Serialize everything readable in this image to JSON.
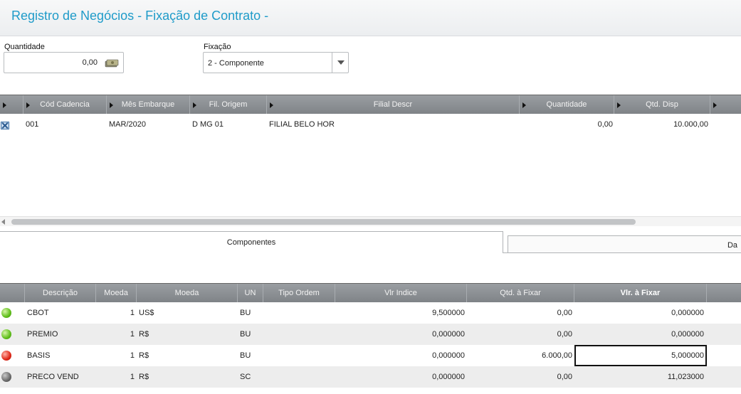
{
  "window": {
    "title": "Registro de Negócios - Fixação de Contrato -"
  },
  "form": {
    "quantidade_label": "Quantidade",
    "quantidade_value": "0,00",
    "fixacao_label": "Fixação",
    "fixacao_value": "2 - Componente"
  },
  "cadencia_grid": {
    "columns": [
      "Cód Cadencia",
      "Mês Embarque",
      "Fil. Origem",
      "Filial Descr",
      "Quantidade",
      "Qtd. Disp"
    ],
    "rows": [
      {
        "checked": true,
        "cod": "001",
        "mes": "MAR/2020",
        "fil_origem": "D MG 01",
        "filial_descr": "FILIAL BELO HOR",
        "quantidade": "0,00",
        "qtd_disp": "10.000,00"
      }
    ]
  },
  "tabs": {
    "componentes": "Componentes",
    "second": "Da"
  },
  "componentes_grid": {
    "columns": [
      "Descrição",
      "Moeda",
      "Moeda",
      "UN",
      "Tipo Ordem",
      "Vlr Indice",
      "Qtd. à Fixar",
      "Vlr. à Fixar"
    ],
    "rows": [
      {
        "status": "green",
        "descricao": "CBOT",
        "moeda_num": "1",
        "moeda": "US$",
        "un": "BU",
        "tipo_ordem": "",
        "vlr_indice": "9,500000",
        "qtd_fixar": "0,00",
        "vlr_fixar": "0,000000"
      },
      {
        "status": "green",
        "descricao": "PREMIO",
        "moeda_num": "1",
        "moeda": "R$",
        "un": "BU",
        "tipo_ordem": "",
        "vlr_indice": "0,000000",
        "qtd_fixar": "0,00",
        "vlr_fixar": "0,000000"
      },
      {
        "status": "red",
        "descricao": "BASIS",
        "moeda_num": "1",
        "moeda": "R$",
        "un": "BU",
        "tipo_ordem": "",
        "vlr_indice": "0,000000",
        "qtd_fixar": "6.000,00",
        "vlr_fixar": "5,000000"
      },
      {
        "status": "gray",
        "descricao": "PRECO VEND",
        "moeda_num": "1",
        "moeda": "R$",
        "un": "SC",
        "tipo_ordem": "",
        "vlr_indice": "0,000000",
        "qtd_fixar": "0,00",
        "vlr_fixar": "11,023000"
      }
    ]
  },
  "icons": {
    "money": "money-icon",
    "dropdown": "chevron-down-icon",
    "checkbox": "checkbox-checked-icon"
  },
  "colors": {
    "title": "#1f9bc9",
    "header": "#8a8e92",
    "green": "#5fbe1a",
    "red": "#e02818",
    "gray": "#6a6a6a"
  }
}
